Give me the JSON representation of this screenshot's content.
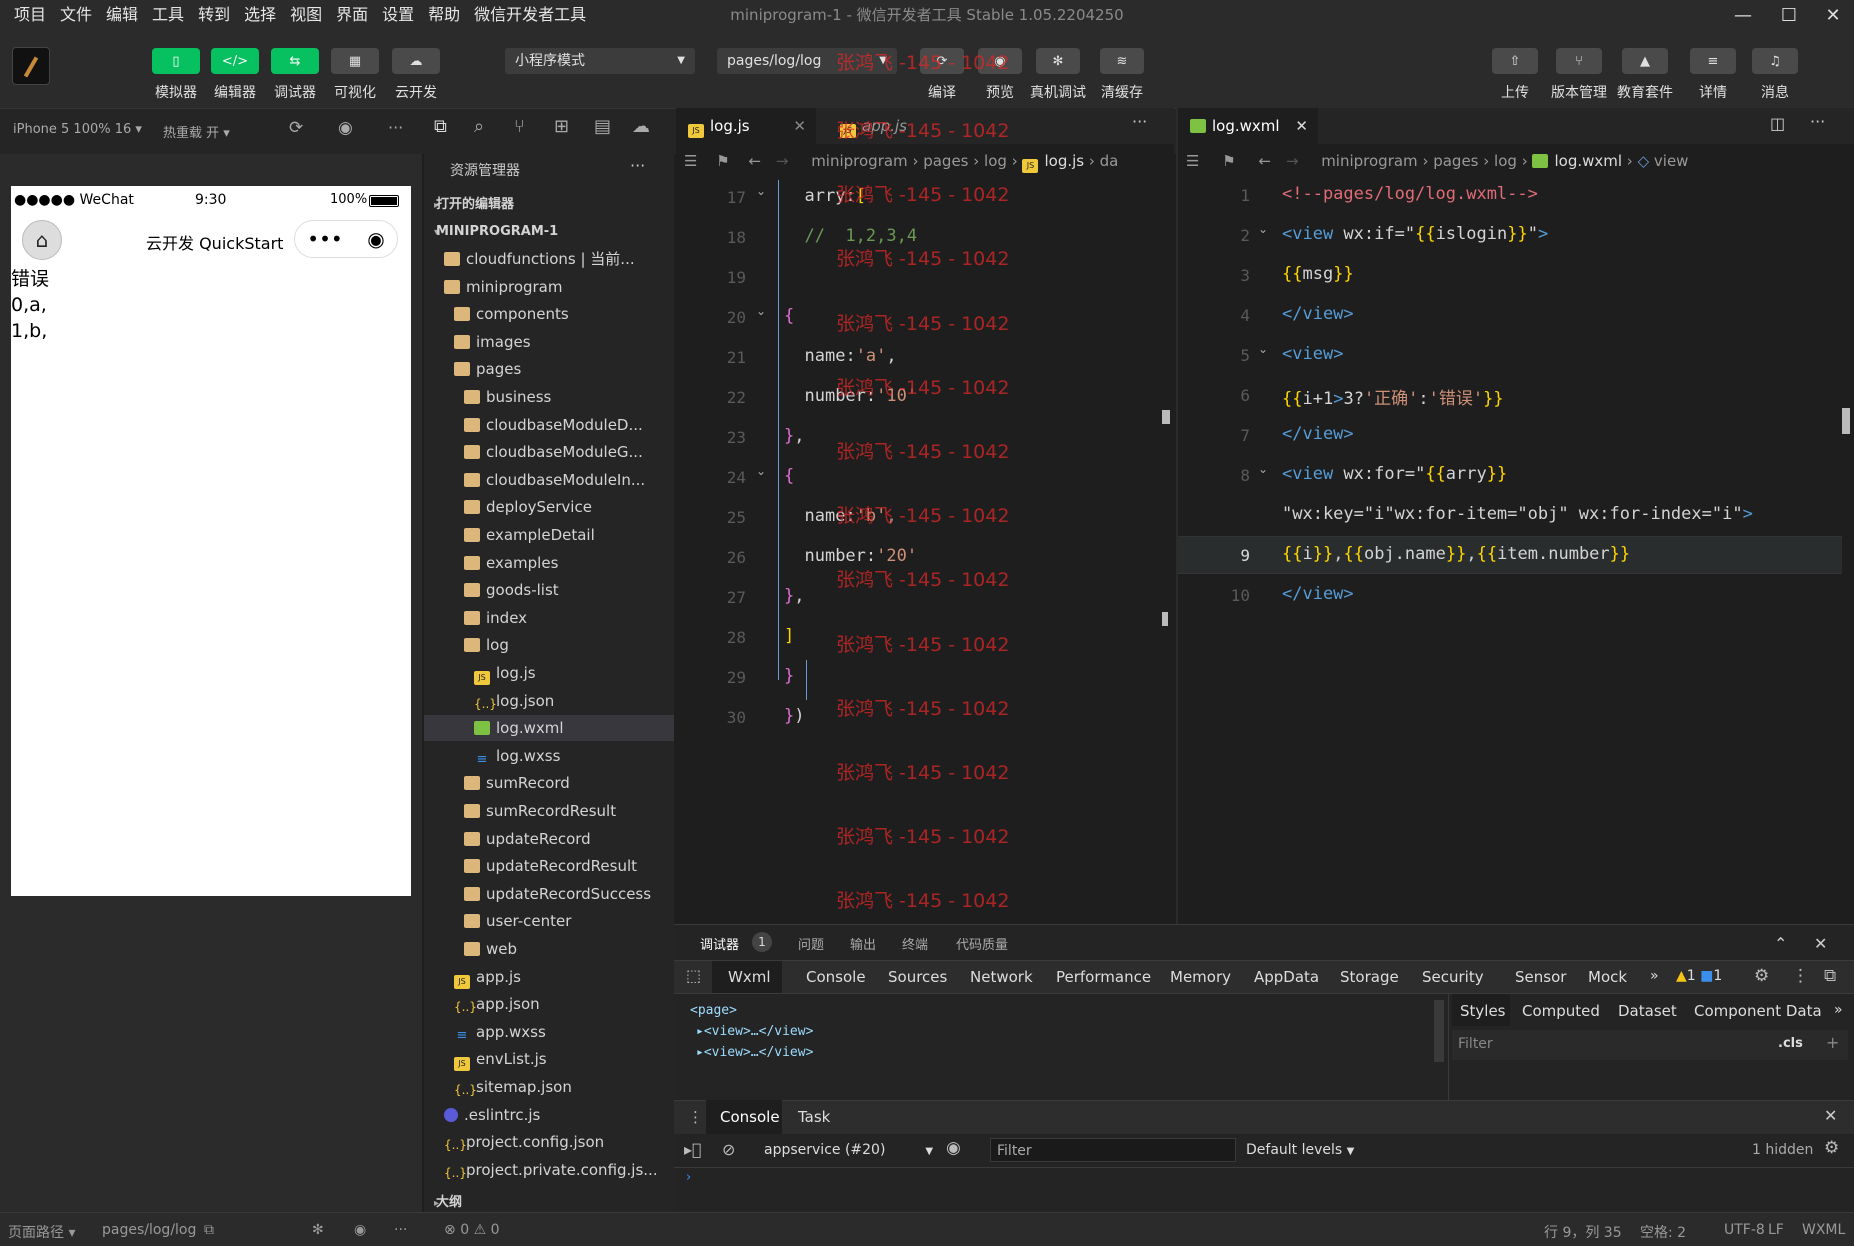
{
  "menu": [
    "项目",
    "文件",
    "编辑",
    "工具",
    "转到",
    "选择",
    "视图",
    "界面",
    "设置",
    "帮助",
    "微信开发者工具"
  ],
  "window_title": "miniprogram-1 - 微信开发者工具 Stable 1.05.2204250",
  "toolbar": {
    "left_buttons": [
      "模拟器",
      "编辑器",
      "调试器",
      "可视化",
      "云开发"
    ],
    "mode_select": "小程序模式",
    "page_select": "pages/log/log",
    "mid_buttons": [
      "编译",
      "预览",
      "真机调试",
      "清缓存"
    ],
    "right_buttons": [
      "上传",
      "版本管理",
      "教育套件",
      "详情",
      "消息"
    ]
  },
  "simulator": {
    "device": "iPhone 5 100% 16",
    "hot_reload": "热重载 开",
    "status_carrier": "●●●●● WeChat",
    "status_time": "9:30",
    "status_battery": "100%",
    "nav_title": "云开发 QuickStart",
    "content_lines": [
      "错误",
      "0,a,",
      "1,b,"
    ]
  },
  "explorer": {
    "title": "资源管理器",
    "open_editors": "打开的编辑器",
    "project": "MINIPROGRAM-1",
    "items": [
      {
        "label": "cloudfunctions | 当前...",
        "depth": 1,
        "type": "folder",
        "open": false
      },
      {
        "label": "miniprogram",
        "depth": 1,
        "type": "folder",
        "open": true
      },
      {
        "label": "components",
        "depth": 2,
        "type": "folder",
        "open": false
      },
      {
        "label": "images",
        "depth": 2,
        "type": "folder",
        "open": false
      },
      {
        "label": "pages",
        "depth": 2,
        "type": "folder",
        "open": true
      },
      {
        "label": "business",
        "depth": 3,
        "type": "folder",
        "open": false
      },
      {
        "label": "cloudbaseModuleD...",
        "depth": 3,
        "type": "folder",
        "open": false
      },
      {
        "label": "cloudbaseModuleG...",
        "depth": 3,
        "type": "folder",
        "open": false
      },
      {
        "label": "cloudbaseModuleIn...",
        "depth": 3,
        "type": "folder",
        "open": false
      },
      {
        "label": "deployService",
        "depth": 3,
        "type": "folder",
        "open": false
      },
      {
        "label": "exampleDetail",
        "depth": 3,
        "type": "folder",
        "open": false
      },
      {
        "label": "examples",
        "depth": 3,
        "type": "folder",
        "open": false
      },
      {
        "label": "goods-list",
        "depth": 3,
        "type": "folder",
        "open": false
      },
      {
        "label": "index",
        "depth": 3,
        "type": "folder",
        "open": false
      },
      {
        "label": "log",
        "depth": 3,
        "type": "folder",
        "open": true
      },
      {
        "label": "log.js",
        "depth": 4,
        "type": "js"
      },
      {
        "label": "log.json",
        "depth": 4,
        "type": "json"
      },
      {
        "label": "log.wxml",
        "depth": 4,
        "type": "wx",
        "selected": true
      },
      {
        "label": "log.wxss",
        "depth": 4,
        "type": "css"
      },
      {
        "label": "sumRecord",
        "depth": 3,
        "type": "folder",
        "open": false
      },
      {
        "label": "sumRecordResult",
        "depth": 3,
        "type": "folder",
        "open": false
      },
      {
        "label": "updateRecord",
        "depth": 3,
        "type": "folder",
        "open": false
      },
      {
        "label": "updateRecordResult",
        "depth": 3,
        "type": "folder",
        "open": false
      },
      {
        "label": "updateRecordSuccess",
        "depth": 3,
        "type": "folder",
        "open": false
      },
      {
        "label": "user-center",
        "depth": 3,
        "type": "folder",
        "open": false
      },
      {
        "label": "web",
        "depth": 3,
        "type": "folder",
        "open": false
      },
      {
        "label": "app.js",
        "depth": 2,
        "type": "js"
      },
      {
        "label": "app.json",
        "depth": 2,
        "type": "json"
      },
      {
        "label": "app.wxss",
        "depth": 2,
        "type": "css"
      },
      {
        "label": "envList.js",
        "depth": 2,
        "type": "js"
      },
      {
        "label": "sitemap.json",
        "depth": 2,
        "type": "json"
      },
      {
        "label": ".eslintrc.js",
        "depth": 1,
        "type": "other"
      },
      {
        "label": "project.config.json",
        "depth": 1,
        "type": "json"
      },
      {
        "label": "project.private.config.js...",
        "depth": 1,
        "type": "json"
      }
    ],
    "outline": "大纲"
  },
  "editor_left": {
    "tab_active": "log.js",
    "tab_other": "app.js",
    "breadcrumb": [
      "miniprogram",
      "pages",
      "log",
      "log.js",
      "da"
    ],
    "line_numbers": [
      "17",
      "18",
      "19",
      "20",
      "21",
      "22",
      "23",
      "24",
      "25",
      "26",
      "27",
      "28",
      "29",
      "30"
    ],
    "lines": [
      "  arry:[",
      "  //  1,2,3,4",
      "",
      "{",
      "  name:'a',",
      "  number:'10'",
      "},",
      "{",
      "  name:'b',",
      "  number:'20'",
      "},",
      "]",
      "}",
      "})"
    ]
  },
  "editor_right": {
    "tab": "log.wxml",
    "breadcrumb": [
      "miniprogram",
      "pages",
      "log",
      "log.wxml",
      "view"
    ],
    "line_numbers": [
      "1",
      "2",
      "3",
      "4",
      "5",
      "6",
      "7",
      "8",
      "",
      "9",
      "10"
    ],
    "lines": [
      "<!--pages/log/log.wxml-->",
      "<view wx:if=\"{{islogin}}\">",
      "{{msg}}",
      "</view>",
      "<view>",
      "{{i+1>3?'正确':'错误'}}",
      "</view>",
      "<view wx:for=\"{{arry}}",
      "\"wx:key=\"i\"wx:for-item=\"obj\" wx:for-index=\"i\">",
      "{{i}},{{obj.name}},{{item.number}}",
      "</view>"
    ]
  },
  "watermark": "张鸿飞 -145 - 1042",
  "devtools": {
    "top_tabs": [
      "调试器",
      "问题",
      "输出",
      "终端",
      "代码质量"
    ],
    "badge": "1",
    "panel_tabs": [
      "Wxml",
      "Console",
      "Sources",
      "Network",
      "Performance",
      "Memory",
      "AppData",
      "Storage",
      "Security",
      "Sensor",
      "Mock"
    ],
    "warn_count": "1",
    "info_count": "1",
    "dom_lines": [
      "<page>",
      "▸<view>…</view>",
      "▸<view>…</view>"
    ],
    "style_tabs": [
      "Styles",
      "Computed",
      "Dataset",
      "Component Data"
    ],
    "filter_placeholder": "Filter",
    "cls": ".cls",
    "console_tabs": [
      "Console",
      "Task"
    ],
    "context": "appservice (#20)",
    "console_filter": "Filter",
    "levels": "Default levels",
    "hidden": "1 hidden"
  },
  "status": {
    "page_path_label": "页面路径",
    "page_path": "pages/log/log",
    "errors": "0",
    "warnings": "0",
    "cursor": "行 9，列 35",
    "spaces": "空格: 2",
    "encoding": "UTF-8",
    "eol": "LF",
    "lang": "WXML"
  },
  "colors": {
    "accent": "#07c160",
    "bg": "#1e1e1e"
  }
}
